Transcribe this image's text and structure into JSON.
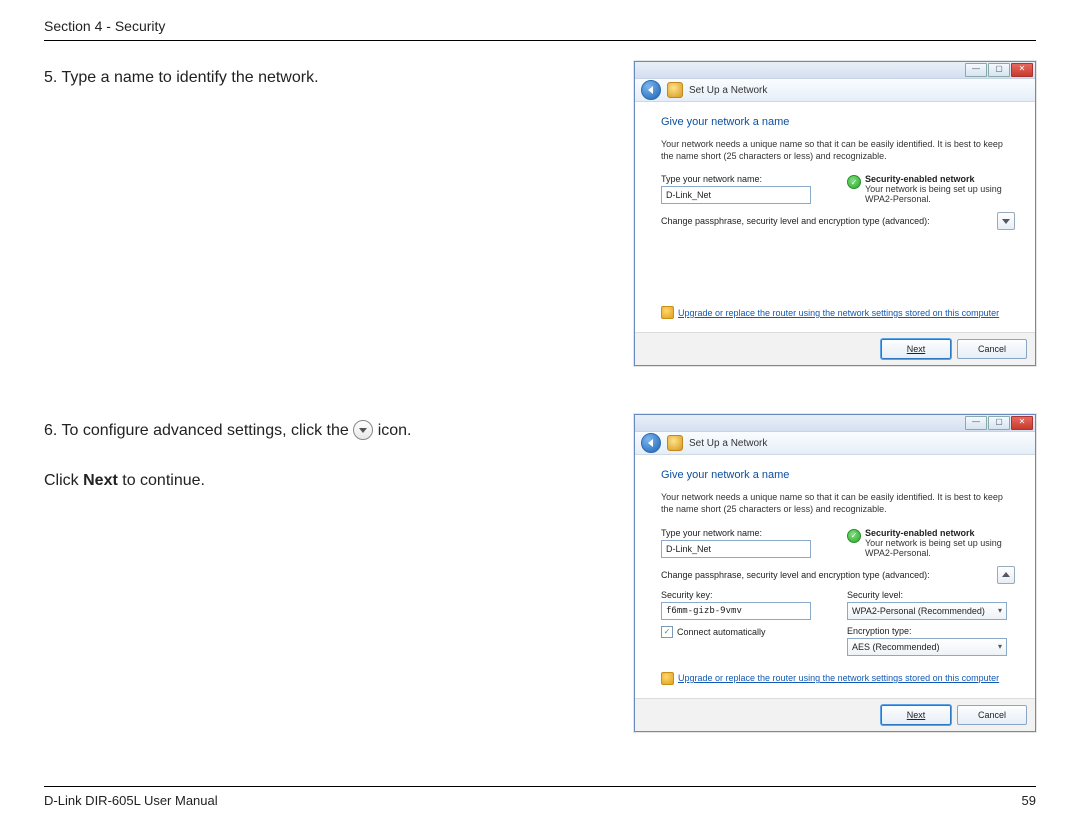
{
  "header": "Section 4 - Security",
  "step5": "5. Type a name to identify the network.",
  "step6a": "6. To configure advanced settings, click the",
  "step6b": "icon.",
  "step6_click": "Click ",
  "step6_next": "Next",
  "step6_cont": " to continue.",
  "dialog": {
    "title": "Set Up a Network",
    "heading": "Give your network a name",
    "desc": "Your network needs a unique name so that it can be easily identified. It is best to keep the name short (25 characters or less) and recognizable.",
    "name_label": "Type your network name:",
    "name_value": "D-Link_Net",
    "sec_title": "Security-enabled network",
    "sec_sub": "Your network is being set up using WPA2-Personal.",
    "adv_line": "Change passphrase, security level and encryption type (advanced):",
    "link": "Upgrade or replace the router using the network settings stored on this computer",
    "next": "Next",
    "cancel": "Cancel"
  },
  "dialog2": {
    "sec_key_label": "Security key:",
    "sec_key_value": "f6mm-gizb-9vmv",
    "connect_label": "Connect automatically",
    "sec_level_label": "Security level:",
    "sec_level_value": "WPA2-Personal (Recommended)",
    "enc_label": "Encryption type:",
    "enc_value": "AES (Recommended)"
  },
  "footer_left": "D-Link DIR-605L User Manual",
  "footer_right": "59"
}
